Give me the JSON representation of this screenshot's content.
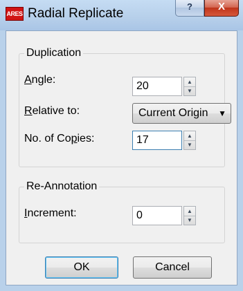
{
  "window": {
    "app_icon_text": "ARES",
    "title": "Radial Replicate",
    "help_button": "?",
    "close_button": "X"
  },
  "duplication": {
    "group_title": "Duplication",
    "angle_label": "Angle:",
    "angle_value": "20",
    "relative_label": "Relative to:",
    "relative_value": "Current Origin",
    "copies_label": "No. of Copies:",
    "copies_value": "17"
  },
  "reannotation": {
    "group_title": "Re-Annotation",
    "increment_label": "Increment:",
    "increment_value": "0"
  },
  "buttons": {
    "ok": "OK",
    "cancel": "Cancel"
  }
}
